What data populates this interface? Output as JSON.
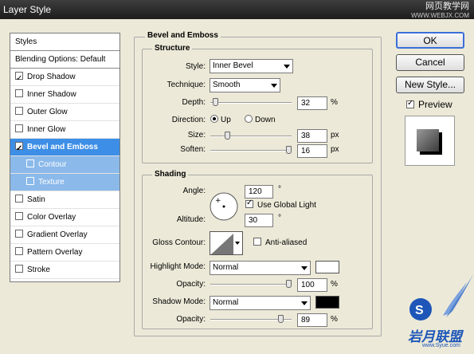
{
  "window": {
    "title": "Layer Style",
    "watermark_top": "网页教学网",
    "watermark_url": "WWW.WEBJX.COM"
  },
  "sidebar": {
    "items": [
      {
        "label": "Styles",
        "checkbox": null,
        "state": "header"
      },
      {
        "label": "Blending Options: Default",
        "checkbox": null,
        "state": "header"
      },
      {
        "label": "Drop Shadow",
        "checkbox": true,
        "state": "normal"
      },
      {
        "label": "Inner Shadow",
        "checkbox": false,
        "state": "normal"
      },
      {
        "label": "Outer Glow",
        "checkbox": false,
        "state": "normal"
      },
      {
        "label": "Inner Glow",
        "checkbox": false,
        "state": "normal"
      },
      {
        "label": "Bevel and Emboss",
        "checkbox": true,
        "state": "selected"
      },
      {
        "label": "Contour",
        "checkbox": false,
        "state": "sub"
      },
      {
        "label": "Texture",
        "checkbox": false,
        "state": "sub"
      },
      {
        "label": "Satin",
        "checkbox": false,
        "state": "normal"
      },
      {
        "label": "Color Overlay",
        "checkbox": false,
        "state": "normal"
      },
      {
        "label": "Gradient Overlay",
        "checkbox": false,
        "state": "normal"
      },
      {
        "label": "Pattern Overlay",
        "checkbox": false,
        "state": "normal"
      },
      {
        "label": "Stroke",
        "checkbox": false,
        "state": "normal"
      }
    ]
  },
  "bevel": {
    "section_title": "Bevel and Emboss",
    "structure": {
      "title": "Structure",
      "style_label": "Style:",
      "style_value": "Inner Bevel",
      "technique_label": "Technique:",
      "technique_value": "Smooth",
      "depth_label": "Depth:",
      "depth_value": "32",
      "depth_unit": "%",
      "depth_level": 0.03,
      "direction_label": "Direction:",
      "direction_up": "Up",
      "direction_down": "Down",
      "direction_selected": "Up",
      "size_label": "Size:",
      "size_value": "38",
      "size_unit": "px",
      "size_level": 0.19,
      "soften_label": "Soften:",
      "soften_value": "16",
      "soften_unit": "px",
      "soften_level": 1.0
    },
    "shading": {
      "title": "Shading",
      "angle_label": "Angle:",
      "angle_value": "120",
      "angle_unit": "°",
      "global_light_label": "Use Global Light",
      "global_light_checked": true,
      "altitude_label": "Altitude:",
      "altitude_value": "30",
      "altitude_unit": "°",
      "gloss_label": "Gloss Contour:",
      "antialiased_label": "Anti-aliased",
      "antialiased_checked": false,
      "highlight_mode_label": "Highlight Mode:",
      "highlight_mode_value": "Normal",
      "highlight_color": "#ffffff",
      "highlight_opacity_label": "Opacity:",
      "highlight_opacity_value": "100",
      "highlight_opacity_unit": "%",
      "highlight_opacity_level": 1.0,
      "shadow_mode_label": "Shadow Mode:",
      "shadow_mode_value": "Normal",
      "shadow_color": "#000000",
      "shadow_opacity_label": "Opacity:",
      "shadow_opacity_value": "89",
      "shadow_opacity_unit": "%",
      "shadow_opacity_level": 0.89
    }
  },
  "buttons": {
    "ok": "OK",
    "cancel": "Cancel",
    "new_style": "New Style...",
    "preview_label": "Preview",
    "preview_checked": true
  },
  "logo": {
    "text": "岩月联盟",
    "url": "www.Syue.com"
  },
  "colors": {
    "selection": "#3d8ee6",
    "sub_selection": "#8bb9ea",
    "ok_border": "#3a6fd9"
  }
}
